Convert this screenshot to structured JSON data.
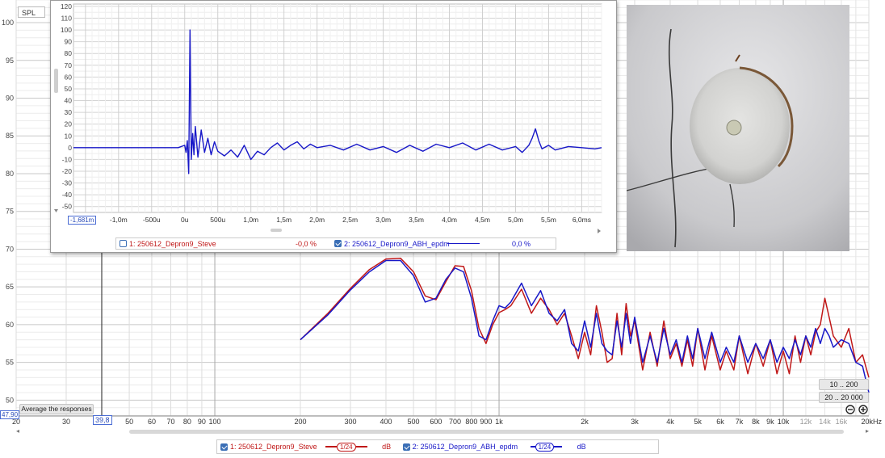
{
  "main_plot": {
    "y_label": "SPL",
    "y_ticks": [
      50,
      55,
      60,
      65,
      70,
      75,
      80,
      85,
      90,
      95,
      100
    ],
    "x_ticks": [
      {
        "v": 20,
        "label": "20"
      },
      {
        "v": 30,
        "label": "30"
      },
      {
        "v": 40,
        "label": ""
      },
      {
        "v": 50,
        "label": "50"
      },
      {
        "v": 60,
        "label": "60"
      },
      {
        "v": 70,
        "label": "70"
      },
      {
        "v": 80,
        "label": "80"
      },
      {
        "v": 90,
        "label": "90"
      },
      {
        "v": 100,
        "label": "100"
      },
      {
        "v": 200,
        "label": "200"
      },
      {
        "v": 300,
        "label": "300"
      },
      {
        "v": 400,
        "label": "400"
      },
      {
        "v": 500,
        "label": "500"
      },
      {
        "v": 600,
        "label": "600"
      },
      {
        "v": 700,
        "label": "700"
      },
      {
        "v": 800,
        "label": "800"
      },
      {
        "v": 900,
        "label": "900"
      },
      {
        "v": 1000,
        "label": "1k"
      },
      {
        "v": 2000,
        "label": "2k"
      },
      {
        "v": 3000,
        "label": "3k"
      },
      {
        "v": 4000,
        "label": "4k"
      },
      {
        "v": 5000,
        "label": "5k"
      },
      {
        "v": 6000,
        "label": "6k"
      },
      {
        "v": 7000,
        "label": "7k"
      },
      {
        "v": 8000,
        "label": "8k"
      },
      {
        "v": 9000,
        "label": "9k"
      },
      {
        "v": 10000,
        "label": "10k"
      },
      {
        "v": 12000,
        "label": "12k"
      },
      {
        "v": 14000,
        "label": "14k"
      },
      {
        "v": 16000,
        "label": "16k"
      },
      {
        "v": 20000,
        "label": "20kHz"
      }
    ],
    "cursor_x_label": "39,8",
    "cursor_y_label": "47,90",
    "average_button": "Average the responses",
    "range_buttons": [
      "10 .. 200",
      "20 .. 20 000"
    ],
    "zoom_out_icon": "zoom-out-icon",
    "zoom_in_icon": "zoom-in-icon",
    "scroll_left": "◂",
    "scroll_right": "▸"
  },
  "legend_bottom": [
    {
      "label": "1: 250612_Depron9_Steve",
      "smoothing": "1/24",
      "unit": "dB",
      "color": "#c01818",
      "checked": true
    },
    {
      "label": "2: 250612_Depron9_ABH_epdm",
      "smoothing": "1/24",
      "unit": "dB",
      "color": "#1818c8",
      "checked": true
    }
  ],
  "ir_window": {
    "y_ticks": [
      120,
      110,
      100,
      90,
      80,
      70,
      60,
      50,
      40,
      30,
      20,
      10,
      0,
      -10,
      -20,
      -30,
      -40,
      -50
    ],
    "x_ticks": [
      "-1,0m",
      "-500u",
      "0u",
      "500u",
      "1,0m",
      "1,5m",
      "2,0m",
      "2,5m",
      "3,0m",
      "3,5m",
      "4,0m",
      "4,5m",
      "5,0m",
      "5,5m",
      "6,0ms"
    ],
    "cursor_label": "-1,681m",
    "legend": [
      {
        "label": "1: 250612_Depron9_Steve",
        "value": "-0,0 %",
        "color": "#c01818",
        "checked": false
      },
      {
        "label": "2: 250612_Depron9_ABH_epdm",
        "value": "0,0 %",
        "color": "#1818c8",
        "checked": true
      }
    ]
  },
  "chart_data": [
    {
      "type": "line",
      "x_scale": "log",
      "ylim": [
        47.9,
        103
      ],
      "xlim": [
        20,
        20000
      ],
      "series": [
        {
          "name": "1: 250612_Depron9_Steve",
          "color": "#c01818",
          "x": [
            200,
            250,
            300,
            350,
            400,
            450,
            500,
            550,
            600,
            650,
            700,
            750,
            800,
            850,
            900,
            950,
            1000,
            1050,
            1100,
            1200,
            1300,
            1400,
            1500,
            1600,
            1700,
            1800,
            1900,
            2000,
            2100,
            2200,
            2300,
            2400,
            2500,
            2600,
            2700,
            2800,
            2900,
            3000,
            3200,
            3400,
            3600,
            3800,
            4000,
            4200,
            4400,
            4600,
            4800,
            5000,
            5300,
            5600,
            6000,
            6300,
            6700,
            7000,
            7500,
            8000,
            8500,
            9000,
            9500,
            10000,
            10500,
            11000,
            11500,
            12000,
            12500,
            13000,
            13500,
            14000,
            14500,
            15000,
            16000,
            17000,
            18000,
            19000,
            20000
          ],
          "y": [
            58.0,
            61.5,
            64.8,
            67.3,
            68.7,
            68.8,
            67.0,
            63.8,
            63.3,
            65.7,
            67.8,
            67.7,
            64.5,
            59.5,
            57.5,
            60.0,
            61.6,
            62.0,
            62.5,
            64.7,
            61.5,
            63.5,
            62.0,
            60.0,
            61.5,
            58.5,
            55.5,
            59.0,
            56.0,
            62.5,
            59.0,
            55.0,
            55.5,
            61.5,
            56.0,
            62.8,
            58.5,
            60.5,
            54.0,
            59.0,
            54.5,
            60.5,
            55.5,
            57.5,
            54.5,
            58.0,
            54.5,
            59.5,
            54.0,
            58.5,
            54.0,
            56.5,
            54.0,
            58.5,
            53.5,
            57.5,
            54.5,
            58.0,
            53.5,
            56.5,
            53.5,
            58.5,
            55.0,
            58.5,
            56.0,
            59.0,
            60.0,
            63.5,
            61.0,
            58.5,
            57.0,
            59.5,
            55.0,
            56.0,
            53.0
          ]
        },
        {
          "name": "2: 250612_Depron9_ABH_epdm",
          "color": "#1818c8",
          "x": [
            200,
            250,
            300,
            350,
            400,
            450,
            500,
            550,
            600,
            650,
            700,
            750,
            800,
            850,
            900,
            950,
            1000,
            1050,
            1100,
            1200,
            1300,
            1400,
            1500,
            1600,
            1700,
            1800,
            1900,
            2000,
            2100,
            2200,
            2300,
            2400,
            2500,
            2600,
            2700,
            2800,
            2900,
            3000,
            3200,
            3400,
            3600,
            3800,
            4000,
            4200,
            4400,
            4600,
            4800,
            5000,
            5300,
            5600,
            6000,
            6300,
            6700,
            7000,
            7500,
            8000,
            8500,
            9000,
            9500,
            10000,
            10500,
            11000,
            11500,
            12000,
            12500,
            13000,
            13500,
            14000,
            14500,
            15000,
            16000,
            17000,
            18000,
            19000,
            20000
          ],
          "y": [
            58.0,
            61.3,
            64.6,
            67.0,
            68.5,
            68.5,
            66.5,
            63.0,
            63.5,
            66.0,
            67.5,
            67.0,
            63.5,
            58.5,
            58.0,
            60.5,
            62.5,
            62.2,
            63.0,
            65.5,
            62.5,
            64.5,
            61.5,
            60.5,
            62.0,
            57.5,
            56.5,
            60.5,
            57.0,
            61.5,
            57.5,
            56.5,
            56.0,
            60.5,
            57.0,
            61.5,
            57.5,
            61.0,
            55.0,
            58.5,
            55.0,
            59.5,
            56.0,
            58.0,
            55.0,
            58.5,
            55.5,
            59.5,
            55.5,
            59.0,
            55.0,
            57.0,
            55.0,
            58.5,
            55.0,
            57.5,
            55.5,
            58.0,
            55.0,
            57.0,
            55.5,
            58.0,
            56.0,
            58.5,
            57.0,
            59.5,
            57.5,
            59.5,
            58.5,
            57.0,
            58.0,
            57.5,
            55.0,
            54.5,
            51.0
          ]
        }
      ]
    },
    {
      "type": "line",
      "title": "",
      "xlim": [
        -1.681,
        6.3
      ],
      "ylim": [
        -55,
        122
      ],
      "series": [
        {
          "name": "2: 250612_Depron9_ABH_epdm",
          "color": "#1818c8",
          "x": [
            -1.681,
            -0.1,
            0.0,
            0.02,
            0.04,
            0.06,
            0.08,
            0.1,
            0.12,
            0.14,
            0.16,
            0.2,
            0.25,
            0.3,
            0.35,
            0.4,
            0.45,
            0.5,
            0.6,
            0.7,
            0.8,
            0.9,
            1.0,
            1.1,
            1.2,
            1.3,
            1.4,
            1.5,
            1.6,
            1.7,
            1.8,
            1.9,
            2.0,
            2.2,
            2.4,
            2.6,
            2.8,
            3.0,
            3.2,
            3.4,
            3.6,
            3.8,
            4.0,
            4.2,
            4.4,
            4.6,
            4.8,
            5.0,
            5.1,
            5.2,
            5.25,
            5.3,
            5.35,
            5.4,
            5.5,
            5.6,
            5.8,
            6.0,
            6.2,
            6.3
          ],
          "y": [
            0,
            0,
            2,
            -4,
            6,
            -22,
            100,
            -10,
            12,
            -6,
            18,
            -8,
            15,
            -4,
            8,
            -6,
            5,
            -3,
            -7,
            -2,
            -8,
            2,
            -10,
            -3,
            -6,
            0,
            4,
            -2,
            2,
            5,
            -1,
            3,
            0,
            2,
            -2,
            3,
            -2,
            1,
            -4,
            2,
            -3,
            3,
            0,
            4,
            -2,
            3,
            -2,
            1,
            -4,
            2,
            8,
            16,
            6,
            -1,
            2,
            -2,
            1,
            0,
            -1,
            0
          ]
        }
      ]
    }
  ]
}
